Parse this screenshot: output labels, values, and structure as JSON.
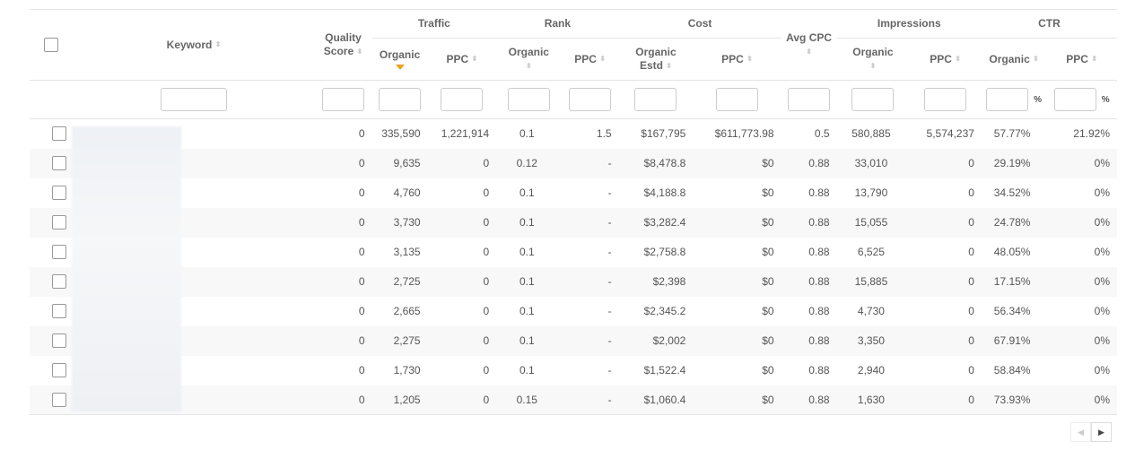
{
  "table": {
    "groups": {
      "traffic": "Traffic",
      "rank": "Rank",
      "cost": "Cost",
      "impressions": "Impressions",
      "ctr": "CTR"
    },
    "headers": {
      "keyword": "Keyword",
      "quality_score_1": "Quality",
      "quality_score_2": "Score",
      "traffic_organic": "Organic",
      "traffic_ppc": "PPC",
      "rank_organic": "Organic",
      "rank_ppc": "PPC",
      "cost_organic_1": "Organic",
      "cost_organic_2": "Estd",
      "cost_ppc": "PPC",
      "avg_cpc": "Avg CPC",
      "impressions_organic": "Organic",
      "impressions_ppc": "PPC",
      "ctr_organic": "Organic",
      "ctr_ppc": "PPC"
    },
    "sort_icon": "⬍",
    "sorted_column": "traffic_organic",
    "sorted_direction": "descending",
    "filter_unit_percent": "%",
    "rows": [
      {
        "keyword": "",
        "quality": "0",
        "traffic_organic": "335,590",
        "traffic_ppc": "1,221,914",
        "rank_organic": "0.1",
        "rank_ppc": "1.5",
        "cost_organic": "$167,795",
        "cost_ppc": "$611,773.98",
        "avg_cpc": "0.5",
        "imp_organic": "580,885",
        "imp_ppc": "5,574,237",
        "ctr_organic": "57.77%",
        "ctr_ppc": "21.92%"
      },
      {
        "keyword": "",
        "quality": "0",
        "traffic_organic": "9,635",
        "traffic_ppc": "0",
        "rank_organic": "0.12",
        "rank_ppc": "-",
        "cost_organic": "$8,478.8",
        "cost_ppc": "$0",
        "avg_cpc": "0.88",
        "imp_organic": "33,010",
        "imp_ppc": "0",
        "ctr_organic": "29.19%",
        "ctr_ppc": "0%"
      },
      {
        "keyword": "",
        "quality": "0",
        "traffic_organic": "4,760",
        "traffic_ppc": "0",
        "rank_organic": "0.1",
        "rank_ppc": "-",
        "cost_organic": "$4,188.8",
        "cost_ppc": "$0",
        "avg_cpc": "0.88",
        "imp_organic": "13,790",
        "imp_ppc": "0",
        "ctr_organic": "34.52%",
        "ctr_ppc": "0%"
      },
      {
        "keyword": "",
        "quality": "0",
        "traffic_organic": "3,730",
        "traffic_ppc": "0",
        "rank_organic": "0.1",
        "rank_ppc": "-",
        "cost_organic": "$3,282.4",
        "cost_ppc": "$0",
        "avg_cpc": "0.88",
        "imp_organic": "15,055",
        "imp_ppc": "0",
        "ctr_organic": "24.78%",
        "ctr_ppc": "0%"
      },
      {
        "keyword": "",
        "quality": "0",
        "traffic_organic": "3,135",
        "traffic_ppc": "0",
        "rank_organic": "0.1",
        "rank_ppc": "-",
        "cost_organic": "$2,758.8",
        "cost_ppc": "$0",
        "avg_cpc": "0.88",
        "imp_organic": "6,525",
        "imp_ppc": "0",
        "ctr_organic": "48.05%",
        "ctr_ppc": "0%"
      },
      {
        "keyword": "",
        "quality": "0",
        "traffic_organic": "2,725",
        "traffic_ppc": "0",
        "rank_organic": "0.1",
        "rank_ppc": "-",
        "cost_organic": "$2,398",
        "cost_ppc": "$0",
        "avg_cpc": "0.88",
        "imp_organic": "15,885",
        "imp_ppc": "0",
        "ctr_organic": "17.15%",
        "ctr_ppc": "0%"
      },
      {
        "keyword": "",
        "quality": "0",
        "traffic_organic": "2,665",
        "traffic_ppc": "0",
        "rank_organic": "0.1",
        "rank_ppc": "-",
        "cost_organic": "$2,345.2",
        "cost_ppc": "$0",
        "avg_cpc": "0.88",
        "imp_organic": "4,730",
        "imp_ppc": "0",
        "ctr_organic": "56.34%",
        "ctr_ppc": "0%"
      },
      {
        "keyword": "",
        "quality": "0",
        "traffic_organic": "2,275",
        "traffic_ppc": "0",
        "rank_organic": "0.1",
        "rank_ppc": "-",
        "cost_organic": "$2,002",
        "cost_ppc": "$0",
        "avg_cpc": "0.88",
        "imp_organic": "3,350",
        "imp_ppc": "0",
        "ctr_organic": "67.91%",
        "ctr_ppc": "0%"
      },
      {
        "keyword": "",
        "quality": "0",
        "traffic_organic": "1,730",
        "traffic_ppc": "0",
        "rank_organic": "0.1",
        "rank_ppc": "-",
        "cost_organic": "$1,522.4",
        "cost_ppc": "$0",
        "avg_cpc": "0.88",
        "imp_organic": "2,940",
        "imp_ppc": "0",
        "ctr_organic": "58.84%",
        "ctr_ppc": "0%"
      },
      {
        "keyword": "",
        "quality": "0",
        "traffic_organic": "1,205",
        "traffic_ppc": "0",
        "rank_organic": "0.15",
        "rank_ppc": "-",
        "cost_organic": "$1,060.4",
        "cost_ppc": "$0",
        "avg_cpc": "0.88",
        "imp_organic": "1,630",
        "imp_ppc": "0",
        "ctr_organic": "73.93%",
        "ctr_ppc": "0%"
      }
    ]
  },
  "pagination": {
    "prev_icon": "◀",
    "next_icon": "▶",
    "prev_enabled": false,
    "next_enabled": true
  },
  "colors": {
    "sort_active": "#f0a020",
    "row_stripe": "#f8f8f8",
    "border": "#e4e4e4"
  }
}
